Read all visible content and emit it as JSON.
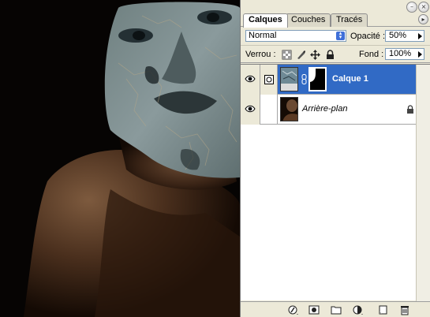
{
  "palette": {
    "tabs": [
      {
        "label": "Calques",
        "active": true
      },
      {
        "label": "Couches",
        "active": false
      },
      {
        "label": "Tracés",
        "active": false
      }
    ],
    "blend_mode": "Normal",
    "opacity_label": "Opacité :",
    "opacity_value": "50%",
    "lock_label": "Verrou :",
    "fill_label": "Fond :",
    "fill_value": "100%",
    "layers": [
      {
        "name": "Calque 1",
        "selected": true,
        "visible": true,
        "has_mask": true
      },
      {
        "name": "Arrière-plan",
        "selected": false,
        "visible": true,
        "locked": true
      }
    ],
    "bottom_icons": [
      "link-layers-icon",
      "add-layer-style-icon",
      "add-mask-icon",
      "new-group-icon",
      "adjustment-layer-icon",
      "new-layer-icon",
      "trash-icon"
    ]
  },
  "colors": {
    "selection": "#316ac5",
    "panel_bg": "#ece9d8"
  }
}
